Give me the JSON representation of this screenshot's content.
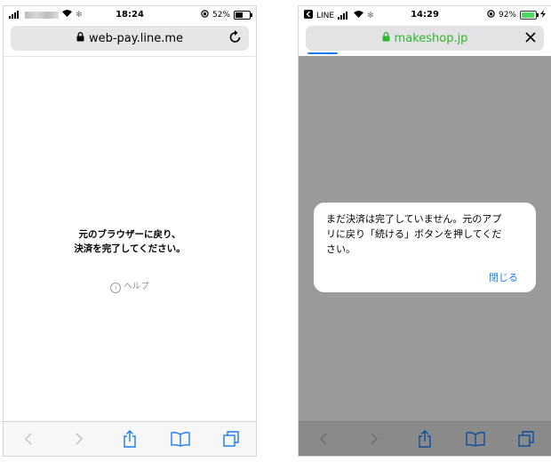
{
  "left_phone": {
    "status": {
      "time": "18:24",
      "battery": "52%",
      "battery_level": 0.52
    },
    "urlbar": {
      "url": "web-pay.line.me",
      "action": "reload"
    },
    "message_line1": "元のブラウザーに戻り、",
    "message_line2": "決済を完了してください。",
    "help_label": "ヘルプ",
    "toolbar_icons": [
      "back-icon",
      "forward-icon",
      "share-icon",
      "bookmarks-icon",
      "tabs-icon"
    ]
  },
  "right_phone": {
    "status": {
      "app": "LINE",
      "time": "14:29",
      "battery": "92%",
      "battery_level": 0.92
    },
    "urlbar": {
      "url": "makeshop.jp",
      "action": "close"
    },
    "page_load_progress": 0.12,
    "dialog": {
      "line1": "まだ決済は完了していません。元のアプ",
      "line2": "リに戻り「続ける」ボタンを押してくだ",
      "line3": "さい。",
      "close_label": "閉じる"
    },
    "toolbar_icons": [
      "back-icon",
      "forward-icon",
      "share-icon",
      "bookmarks-icon",
      "tabs-icon"
    ]
  },
  "colors": {
    "accent": "#1a7cf5",
    "lock_green": "#2eb82e",
    "url_green": "#2eb82e",
    "overlay_gray": "#9a9a9a",
    "battery_green": "#4cd964"
  }
}
